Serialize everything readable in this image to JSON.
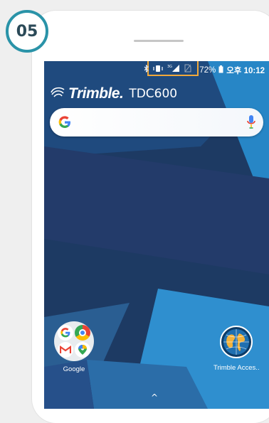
{
  "step": {
    "number": "05"
  },
  "status_bar": {
    "battery_text": "72%",
    "time_text": "오후 10:12",
    "network_label": "3G",
    "highlight_color": "#f2a93b"
  },
  "home": {
    "brand": "Trimble.",
    "model": "TDC600",
    "search": {
      "logo": "G",
      "mic": "mic-icon"
    },
    "apps": [
      {
        "label": "Google"
      },
      {
        "label": "Trimble Acces.."
      }
    ],
    "drawer_hint": "^"
  },
  "colors": {
    "badge_ring": "#2a93a8",
    "screen_dark": "#1d3a63",
    "screen_light": "#2f8fcf"
  }
}
